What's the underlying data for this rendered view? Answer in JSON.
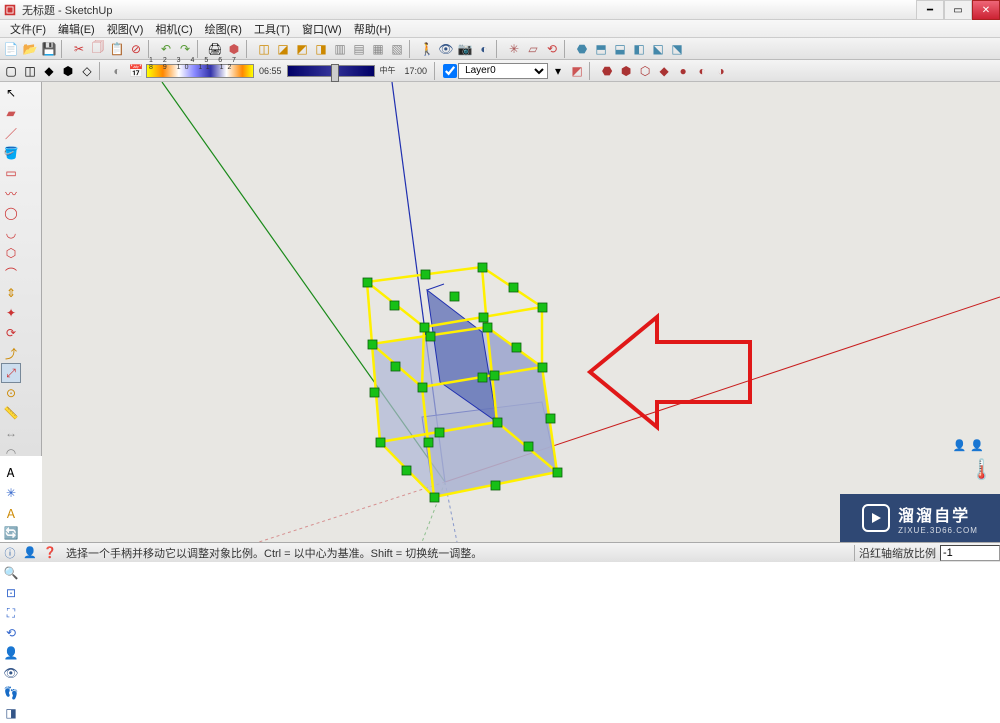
{
  "title": "无标题 - SketchUp",
  "menu": {
    "file": "文件(F)",
    "edit": "编辑(E)",
    "view": "视图(V)",
    "camera": "相机(C)",
    "draw": "绘图(R)",
    "tools": "工具(T)",
    "window": "窗口(W)",
    "help": "帮助(H)"
  },
  "time": {
    "scale": "1 2 3 4 5 6 7 8 9 10 11 12",
    "start": "06:55",
    "mid": "中午",
    "end": "17:00"
  },
  "layer": {
    "checked": true,
    "current": "Layer0"
  },
  "status": {
    "hint": "选择一个手柄并移动它以调整对象比例。Ctrl = 以中心为基准。Shift = 切换统一调整。",
    "measure_label": "沿红轴缩放比例",
    "measure_value": "-1"
  },
  "watermark": {
    "brand": "溜溜自学",
    "url": "ZIXUE.3D66.COM"
  },
  "colors": {
    "viewport_bg": "#e8e7e3",
    "axis_green": "#1a8a1a",
    "axis_red": "#c81e1e",
    "axis_blue": "#2030b0",
    "scale_box": "#fff000",
    "scale_grip": "#17c017",
    "arrow": "#e01818"
  }
}
